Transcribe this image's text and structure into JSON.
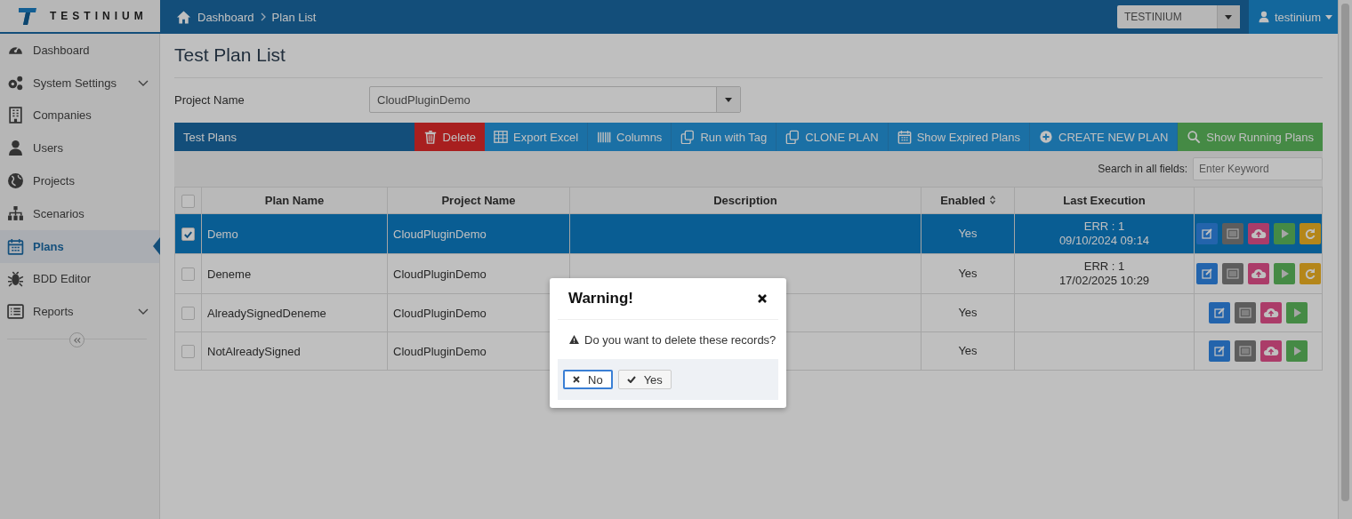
{
  "app": {
    "logo_text": "TESTINIUM"
  },
  "breadcrumb": [
    "Dashboard",
    "Plan List"
  ],
  "company_select": {
    "value": "TESTINIUM"
  },
  "user_menu": {
    "label": "testinium"
  },
  "sidebar": {
    "items": [
      {
        "label": "Dashboard",
        "selected": false,
        "submenu": false
      },
      {
        "label": "System Settings",
        "selected": false,
        "submenu": true
      },
      {
        "label": "Companies",
        "selected": false,
        "submenu": false
      },
      {
        "label": "Users",
        "selected": false,
        "submenu": false
      },
      {
        "label": "Projects",
        "selected": false,
        "submenu": false
      },
      {
        "label": "Scenarios",
        "selected": false,
        "submenu": false
      },
      {
        "label": "Plans",
        "selected": true,
        "submenu": false
      },
      {
        "label": "BDD Editor",
        "selected": false,
        "submenu": false
      },
      {
        "label": "Reports",
        "selected": false,
        "submenu": true
      }
    ]
  },
  "page": {
    "title": "Test Plan List",
    "project_label": "Project Name",
    "project_value": "CloudPluginDemo"
  },
  "toolbar": {
    "title": "Test Plans",
    "buttons": [
      {
        "label": "Delete",
        "kind": "danger"
      },
      {
        "label": "Export Excel",
        "kind": "primary"
      },
      {
        "label": "Columns",
        "kind": "primary"
      },
      {
        "label": "Run with Tag",
        "kind": "primary"
      },
      {
        "label": "CLONE PLAN",
        "kind": "primary"
      },
      {
        "label": "Show Expired Plans",
        "kind": "primary"
      },
      {
        "label": "CREATE NEW PLAN",
        "kind": "primary"
      },
      {
        "label": "Show Running Plans",
        "kind": "success"
      }
    ]
  },
  "search": {
    "label": "Search in all fields:",
    "placeholder": "Enter Keyword"
  },
  "table": {
    "select_all_checked": false,
    "columns": [
      {
        "label": "Plan Name",
        "sortable": false
      },
      {
        "label": "Project Name",
        "sortable": false
      },
      {
        "label": "Description",
        "sortable": false
      },
      {
        "label": "Enabled",
        "sortable": true
      },
      {
        "label": "Last Execution",
        "sortable": false
      }
    ],
    "rows": [
      {
        "checked": true,
        "selected": true,
        "plan_name": "Demo",
        "project_name": "CloudPluginDemo",
        "enabled": "Yes",
        "last_execution": [
          "ERR : 1",
          "09/10/2024 09:14"
        ],
        "actions": [
          {
            "kind": "edit"
          },
          {
            "kind": "report"
          },
          {
            "kind": "upload"
          },
          {
            "kind": "run"
          },
          {
            "kind": "rerun"
          }
        ]
      },
      {
        "checked": false,
        "selected": false,
        "plan_name": "Deneme",
        "project_name": "CloudPluginDemo",
        "enabled": "Yes",
        "last_execution": [
          "ERR : 1",
          "17/02/2025 10:29"
        ],
        "actions": [
          {
            "kind": "edit"
          },
          {
            "kind": "report"
          },
          {
            "kind": "upload"
          },
          {
            "kind": "run"
          },
          {
            "kind": "rerun"
          }
        ]
      },
      {
        "checked": false,
        "selected": false,
        "plan_name": "AlreadySignedDeneme",
        "project_name": "CloudPluginDemo",
        "enabled": "Yes",
        "actions": [
          {
            "kind": "edit"
          },
          {
            "kind": "report"
          },
          {
            "kind": "upload"
          },
          {
            "kind": "run"
          }
        ]
      },
      {
        "checked": false,
        "selected": false,
        "plan_name": "NotAlreadySigned",
        "project_name": "CloudPluginDemo",
        "enabled": "Yes",
        "actions": [
          {
            "kind": "edit"
          },
          {
            "kind": "report"
          },
          {
            "kind": "upload"
          },
          {
            "kind": "run"
          }
        ]
      }
    ]
  },
  "dialog": {
    "title": "Warning!",
    "message": "Do you want to delete these records?",
    "buttons": [
      {
        "label": "No",
        "kind": "no",
        "focused": true
      },
      {
        "label": "Yes",
        "kind": "yes",
        "focused": false
      }
    ]
  }
}
